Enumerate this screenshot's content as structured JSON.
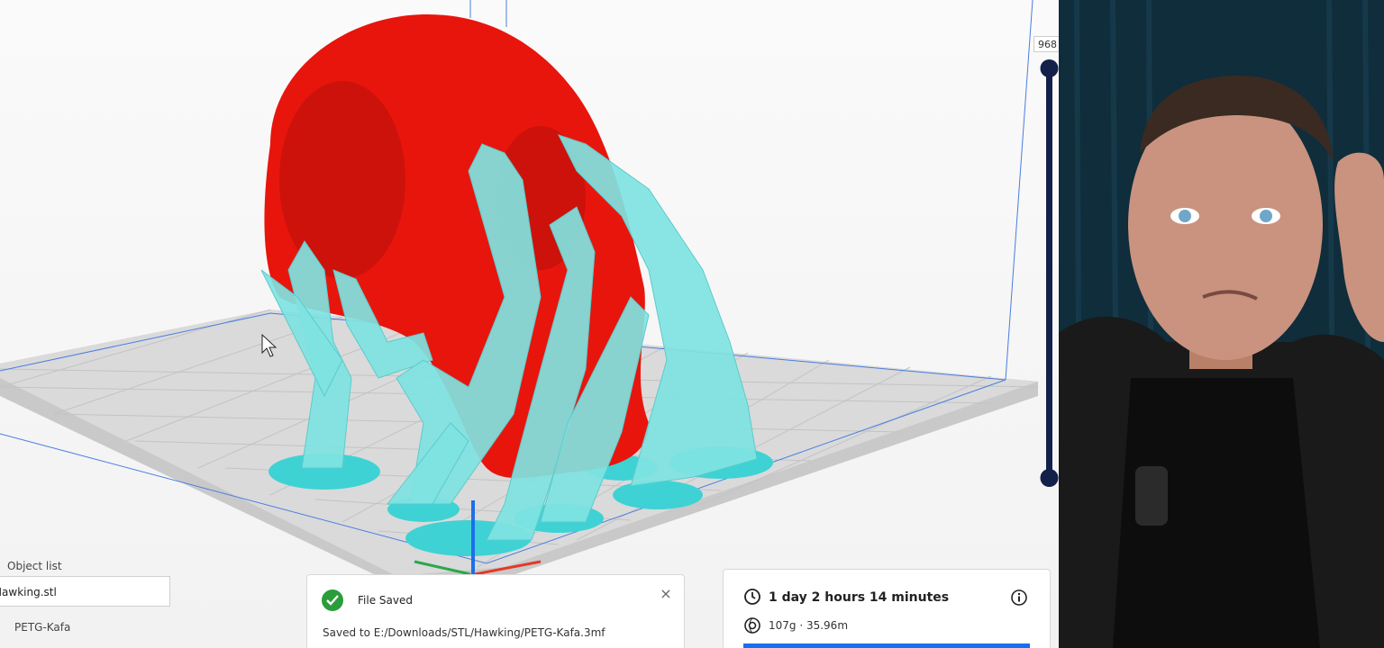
{
  "layer_view": {
    "current_layer": "968"
  },
  "object_list": {
    "title": "Object list",
    "file_name": "Hawking.stl",
    "material": "PETG-Kafa"
  },
  "notification": {
    "title": "File Saved",
    "message": "Saved to E:/Downloads/STL/Hawking/PETG-Kafa.3mf",
    "close_symbol": "×"
  },
  "print_estimate": {
    "time": "1 day 2 hours 14 minutes",
    "material_usage": "107g · 35.96m"
  },
  "colors": {
    "model": "#e8150d",
    "support": "#7fe3e1",
    "accent": "#196ef0",
    "slider": "#12204a"
  },
  "icons": [
    "check-icon",
    "close-icon",
    "clock-icon",
    "info-icon",
    "spool-icon",
    "cursor-icon",
    "layer-handle-icon"
  ]
}
